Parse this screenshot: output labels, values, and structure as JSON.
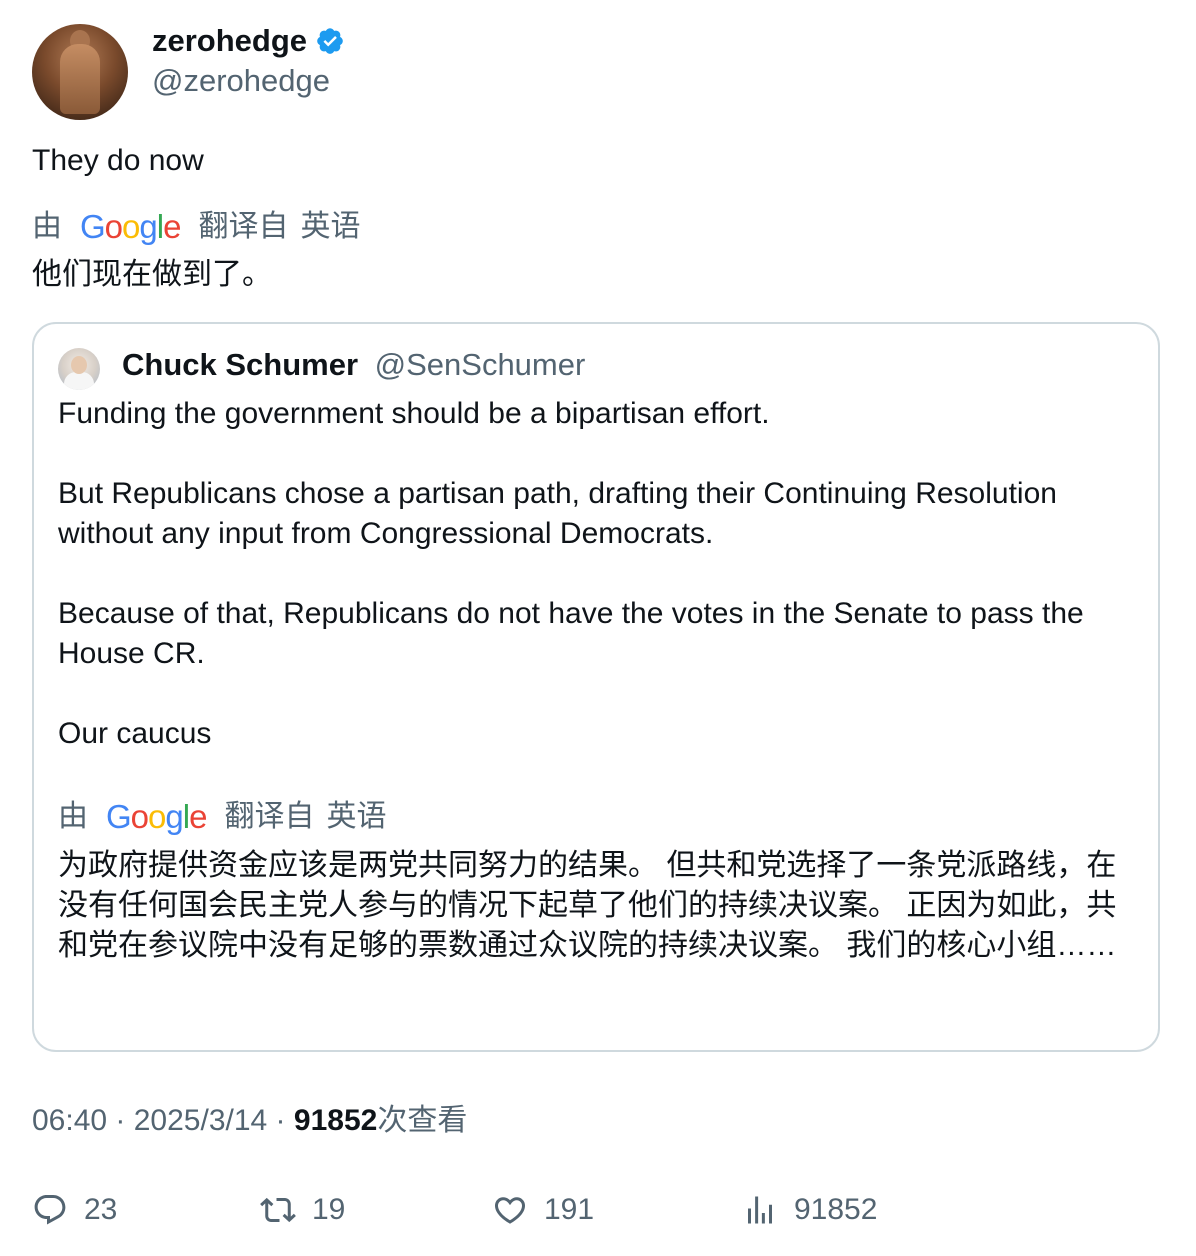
{
  "author": {
    "name": "zerohedge",
    "handle": "@zerohedge",
    "verified": true
  },
  "tweet": {
    "text": "They do now",
    "translation": "他们现在做到了。"
  },
  "translate_label": {
    "by": "由",
    "google": "Google",
    "translated_from": "翻译自",
    "language": "英语"
  },
  "quote": {
    "name": "Chuck Schumer",
    "handle": "@SenSchumer",
    "paragraphs": [
      "Funding the government should be a bipartisan effort.",
      "But Republicans chose a partisan path, drafting their Continuing Resolution without any input from Congressional Democrats.",
      "Because of that, Republicans do not have the votes in the Senate to pass the House CR.",
      "Our caucus"
    ],
    "translation": "为政府提供资金应该是两党共同努力的结果。 但共和党选择了一条党派路线，在没有任何国会民主党人参与的情况下起草了他们的持续决议案。 正因为如此，共和党在参议院中没有足够的票数通过众议院的持续决议案。 我们的核心小组……"
  },
  "meta": {
    "time": "06:40",
    "separator": " · ",
    "date": "2025/3/14",
    "views_count": "91852",
    "views_label": "次查看"
  },
  "actions": {
    "replies": "23",
    "retweets": "19",
    "likes": "191",
    "views": "91852"
  },
  "colors": {
    "verified": "#1d9bf0",
    "secondary_text": "#536471",
    "border": "#cfd9de"
  },
  "icons": [
    "verified-badge-icon",
    "reply-icon",
    "retweet-icon",
    "like-icon",
    "views-icon"
  ]
}
